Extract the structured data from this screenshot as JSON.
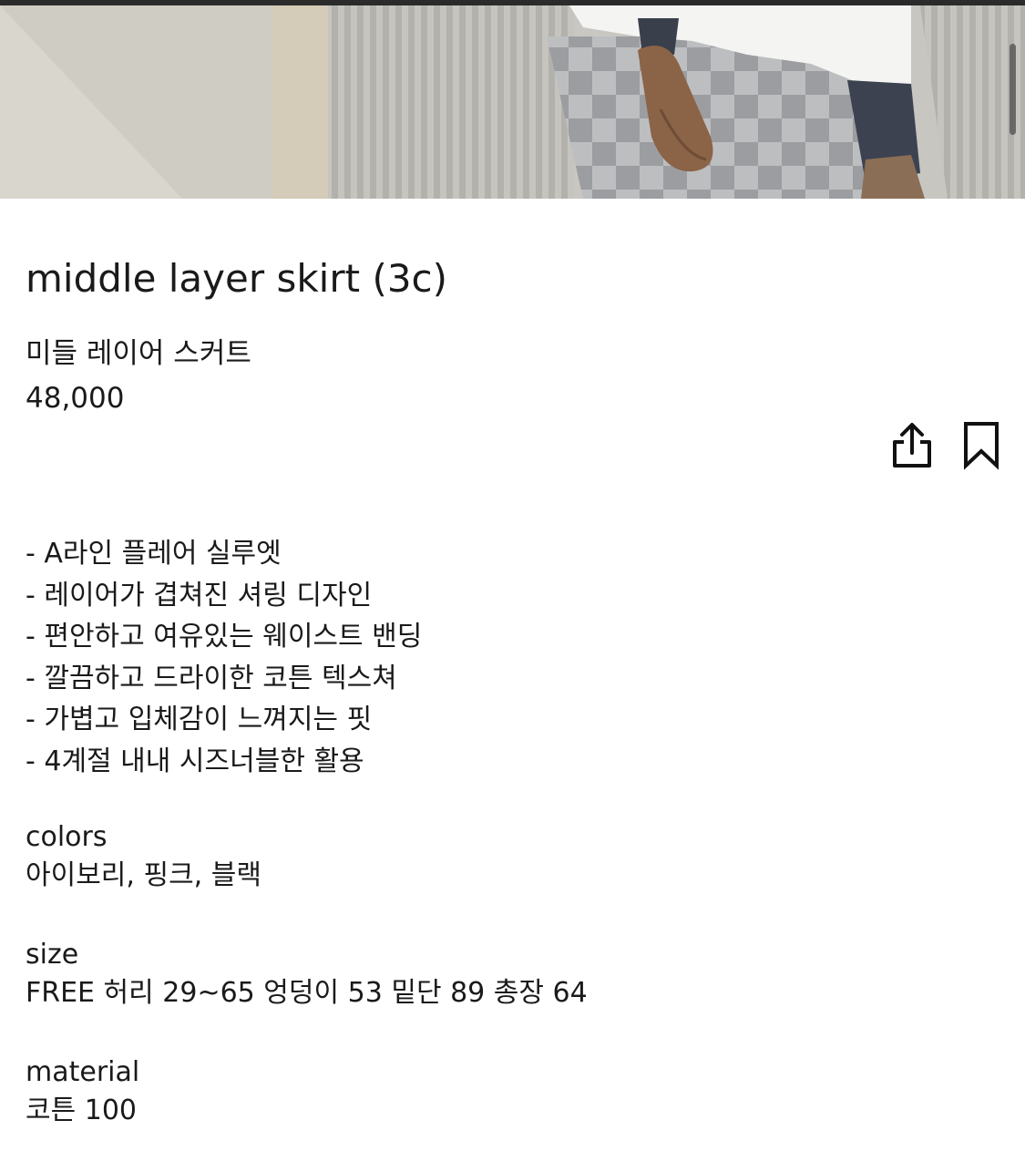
{
  "product": {
    "title": "middle layer skirt (3c)",
    "subtitle": "미들 레이어 스커트",
    "price": "48,000"
  },
  "actions": {
    "share_icon": "share-icon",
    "bookmark_icon": "bookmark-icon"
  },
  "features": [
    "- A라인 플레어 실루엣",
    "- 레이어가 겹쳐진 셔링 디자인",
    "- 편안하고 여유있는 웨이스트 밴딩",
    "- 깔끔하고 드라이한 코튼 텍스쳐",
    "- 가볍고 입체감이 느껴지는 핏",
    "- 4계절 내내 시즈너블한 활용"
  ],
  "specs": {
    "colors": {
      "label": "colors",
      "value": "아이보리, 핑크, 블랙"
    },
    "size": {
      "label": "size",
      "value": "FREE 허리 29~65 엉덩이 53 밑단 89 총장 64"
    },
    "material": {
      "label": "material",
      "value": "코튼 100"
    }
  },
  "colors": {
    "text": "#1a1a1a",
    "background": "#ffffff"
  }
}
